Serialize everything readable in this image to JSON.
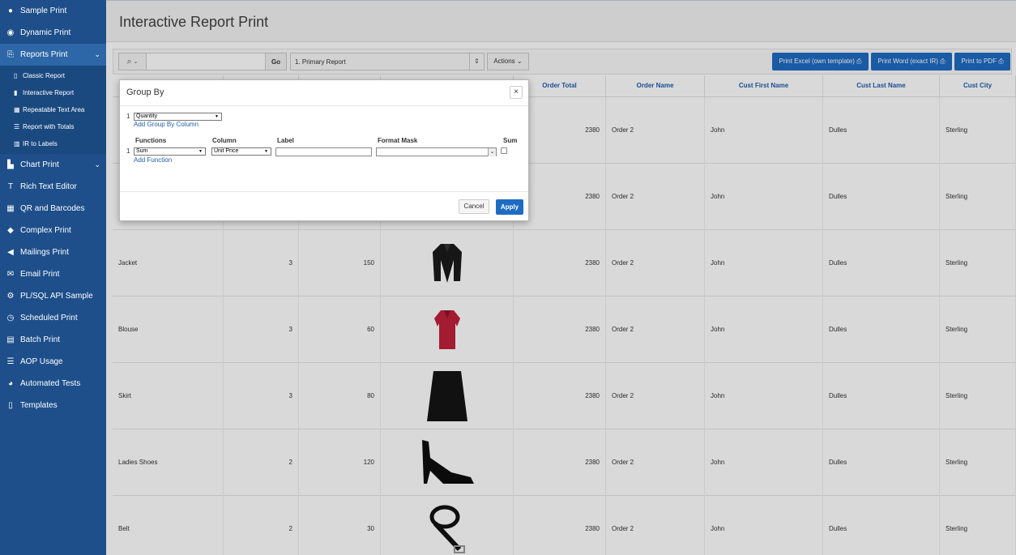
{
  "sidebar": {
    "items": [
      {
        "label": "Sample Print",
        "icon": "circle-icon"
      },
      {
        "label": "Dynamic Print",
        "icon": "eye-icon"
      },
      {
        "label": "Reports Print",
        "icon": "reports-icon"
      },
      {
        "label": "Chart Print",
        "icon": "chart-icon"
      },
      {
        "label": "Rich Text Editor",
        "icon": "text-icon"
      },
      {
        "label": "QR and Barcodes",
        "icon": "qr-icon"
      },
      {
        "label": "Complex Print",
        "icon": "graduation-icon"
      },
      {
        "label": "Mailings Print",
        "icon": "bullhorn-icon"
      },
      {
        "label": "Email Print",
        "icon": "envelope-icon"
      },
      {
        "label": "PL/SQL API Sample",
        "icon": "gear-icon"
      },
      {
        "label": "Scheduled Print",
        "icon": "clock-icon"
      },
      {
        "label": "Batch Print",
        "icon": "file-icon"
      },
      {
        "label": "AOP Usage",
        "icon": "list-icon"
      },
      {
        "label": "Automated Tests",
        "icon": "dashboard-icon"
      },
      {
        "label": "Templates",
        "icon": "document-icon"
      }
    ],
    "sub_items": [
      {
        "label": "Classic Report"
      },
      {
        "label": "Interactive Report"
      },
      {
        "label": "Repeatable Text Area"
      },
      {
        "label": "Report with Totals"
      },
      {
        "label": "IR to Labels"
      }
    ]
  },
  "page": {
    "title": "Interactive Report Print"
  },
  "toolbar": {
    "go_label": "Go",
    "report_select": "1. Primary Report",
    "actions_label": "Actions",
    "btn_excel": "Print Excel (own template)",
    "btn_word": "Print Word (exact IR)",
    "btn_pdf": "Print to PDF"
  },
  "table": {
    "headers": [
      "Order Total",
      "Order Name",
      "Cust First Name",
      "Cust Last Name",
      "Cust City"
    ],
    "rows": [
      {
        "product": "",
        "qty": "",
        "price": "",
        "image": "",
        "total": "2380",
        "order": "Order 2",
        "first": "John",
        "last": "Dulles",
        "city": "Sterling"
      },
      {
        "product": "",
        "qty": "",
        "price": "",
        "image": "",
        "total": "2380",
        "order": "Order 2",
        "first": "John",
        "last": "Dulles",
        "city": "Sterling"
      },
      {
        "product": "Jacket",
        "qty": "3",
        "price": "150",
        "image": "jacket",
        "total": "2380",
        "order": "Order 2",
        "first": "John",
        "last": "Dulles",
        "city": "Sterling"
      },
      {
        "product": "Blouse",
        "qty": "3",
        "price": "60",
        "image": "blouse",
        "total": "2380",
        "order": "Order 2",
        "first": "John",
        "last": "Dulles",
        "city": "Sterling"
      },
      {
        "product": "Skirt",
        "qty": "3",
        "price": "80",
        "image": "skirt",
        "total": "2380",
        "order": "Order 2",
        "first": "John",
        "last": "Dulles",
        "city": "Sterling"
      },
      {
        "product": "Ladies Shoes",
        "qty": "2",
        "price": "120",
        "image": "shoes",
        "total": "2380",
        "order": "Order 2",
        "first": "John",
        "last": "Dulles",
        "city": "Sterling"
      },
      {
        "product": "Belt",
        "qty": "2",
        "price": "30",
        "image": "belt",
        "total": "2380",
        "order": "Order 2",
        "first": "John",
        "last": "Dulles",
        "city": "Sterling"
      }
    ]
  },
  "dialog": {
    "title": "Group By",
    "close": "×",
    "group_row_num": "1",
    "group_column": "Quantity",
    "add_group_by": "Add Group By Column",
    "headers": {
      "functions": "Functions",
      "column": "Column",
      "label": "Label",
      "format_mask": "Format Mask",
      "sum": "Sum"
    },
    "func_row_num": "1",
    "function": "Sum",
    "column": "Unit Price",
    "add_function": "Add Function",
    "cancel": "Cancel",
    "apply": "Apply"
  }
}
